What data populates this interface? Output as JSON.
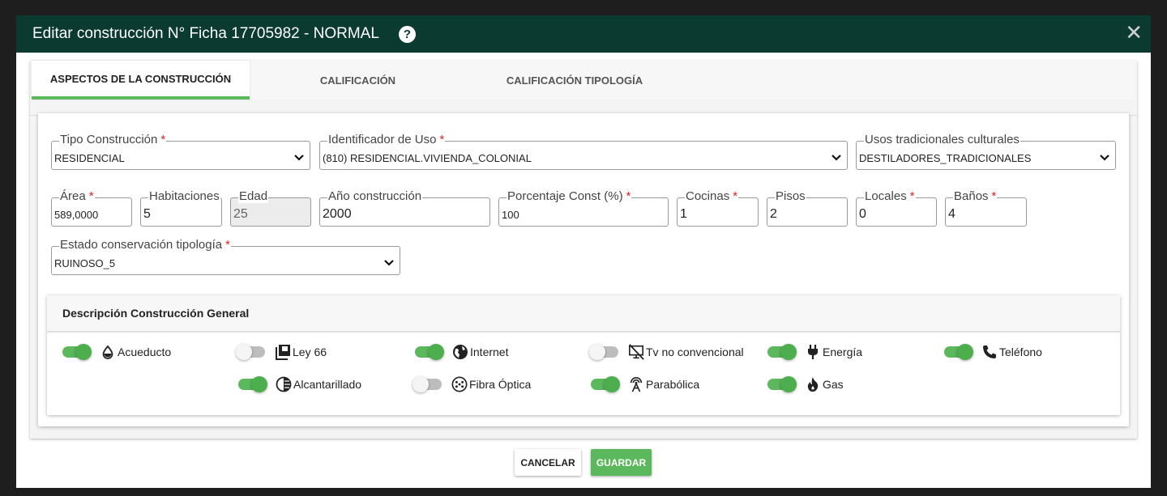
{
  "modal": {
    "title": "Editar construcción N° Ficha 17705982 - NORMAL",
    "help_icon": "question-circle-icon",
    "close_icon": "close-icon",
    "colors": {
      "header": "#0b3a30",
      "accent": "#5cb85c",
      "required": "#d22222"
    }
  },
  "tabs": [
    {
      "label": "ASPECTOS DE LA CONSTRUCCIÓN",
      "active": true
    },
    {
      "label": "CALIFICACIÓN",
      "active": false
    },
    {
      "label": "CALIFICACIÓN TIPOLOGÍA",
      "active": false
    }
  ],
  "fields": {
    "tipo_construccion": {
      "label": "Tipo Construcción",
      "value": "RESIDENCIAL",
      "required": true
    },
    "identificador_uso": {
      "label": "Identificador de Uso",
      "value": "(810) RESIDENCIAL.VIVIENDA_COLONIAL",
      "required": true
    },
    "usos_tradicionales": {
      "label": "Usos tradicionales culturales",
      "value": "DESTILADORES_TRADICIONALES",
      "required": false
    },
    "area": {
      "label": "Área",
      "value": "589,0000",
      "required": true
    },
    "habitaciones": {
      "label": "Habitaciones",
      "value": "5",
      "required": false
    },
    "edad": {
      "label": "Edad",
      "value": "25",
      "required": false,
      "disabled": true
    },
    "anio_construccion": {
      "label": "Año construcción",
      "value": "2000",
      "required": false
    },
    "porcentaje_const": {
      "label": "Porcentaje Const (%)",
      "value": "100",
      "required": true
    },
    "cocinas": {
      "label": "Cocinas",
      "value": "1",
      "required": true
    },
    "pisos": {
      "label": "Pisos",
      "value": "2",
      "required": false
    },
    "locales": {
      "label": "Locales",
      "value": "0",
      "required": true
    },
    "banos": {
      "label": "Baños",
      "value": "4",
      "required": true
    },
    "estado_conservacion": {
      "label": "Estado conservación tipología",
      "value": "RUINOSO_5",
      "required": true
    }
  },
  "required_mark": "*",
  "description": {
    "title": "Descripción Construcción General",
    "services": [
      {
        "label": "Acueducto",
        "icon": "water-drop-icon",
        "on": true
      },
      {
        "label": "Ley 66",
        "icon": "book-icon",
        "on": false
      },
      {
        "label": "Internet",
        "icon": "globe-icon",
        "on": true
      },
      {
        "label": "Tv no convencional",
        "icon": "tv-off-icon",
        "on": false
      },
      {
        "label": "Energía",
        "icon": "plug-icon",
        "on": true
      },
      {
        "label": "Teléfono",
        "icon": "phone-icon",
        "on": true
      },
      {
        "label": "Alcantarillado",
        "icon": "half-circle-icon",
        "on": true
      },
      {
        "label": "Fibra Óptica",
        "icon": "fiber-connector-icon",
        "on": false
      },
      {
        "label": "Parabólica",
        "icon": "antenna-icon",
        "on": true
      },
      {
        "label": "Gas",
        "icon": "fire-icon",
        "on": true
      }
    ]
  },
  "buttons": {
    "cancel": "CANCELAR",
    "save": "GUARDAR"
  }
}
